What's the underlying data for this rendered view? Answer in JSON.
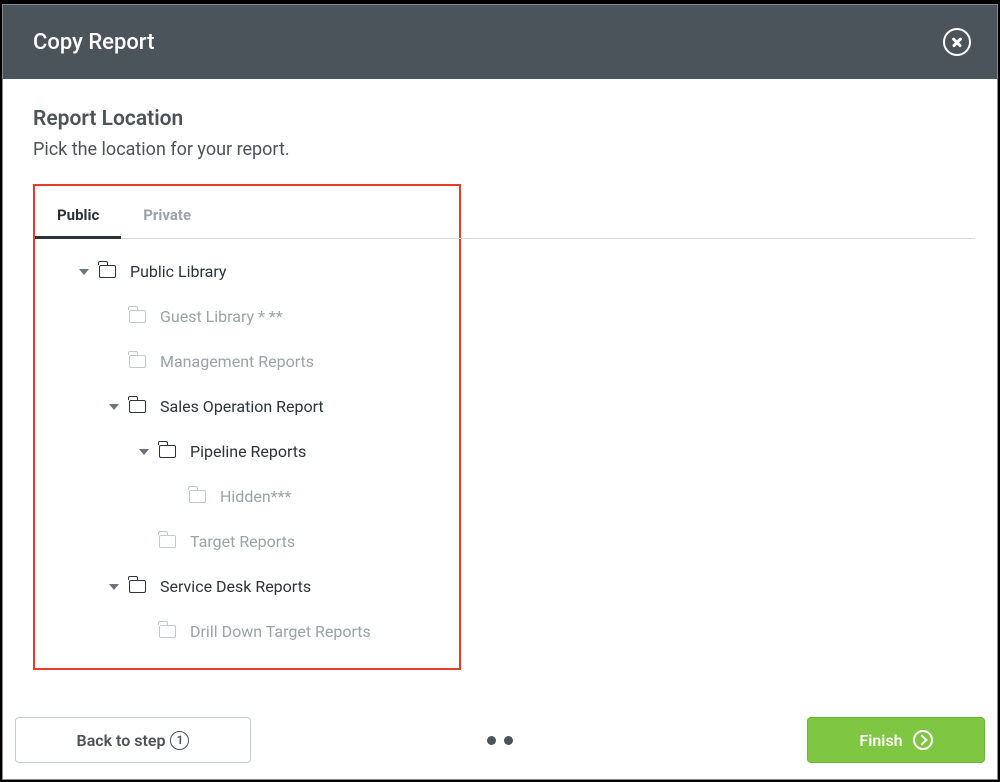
{
  "header": {
    "title": "Copy Report"
  },
  "body": {
    "section_title": "Report Location",
    "section_desc": "Pick the location for your report."
  },
  "tabs": {
    "public": "Public",
    "private": "Private",
    "active": "public"
  },
  "tree": {
    "public_library": "Public Library",
    "guest_library": "Guest Library * **",
    "management_reports": "Management Reports",
    "sales_operation_report": "Sales Operation Report",
    "pipeline_reports": "Pipeline Reports",
    "hidden": "Hidden***",
    "target_reports": "Target Reports",
    "service_desk_reports": "Service Desk Reports",
    "drill_down_target_reports": "Drill Down Target Reports"
  },
  "footer": {
    "back_label": "Back to step",
    "back_step_number": "1",
    "finish_label": "Finish",
    "dot_count": 2
  }
}
